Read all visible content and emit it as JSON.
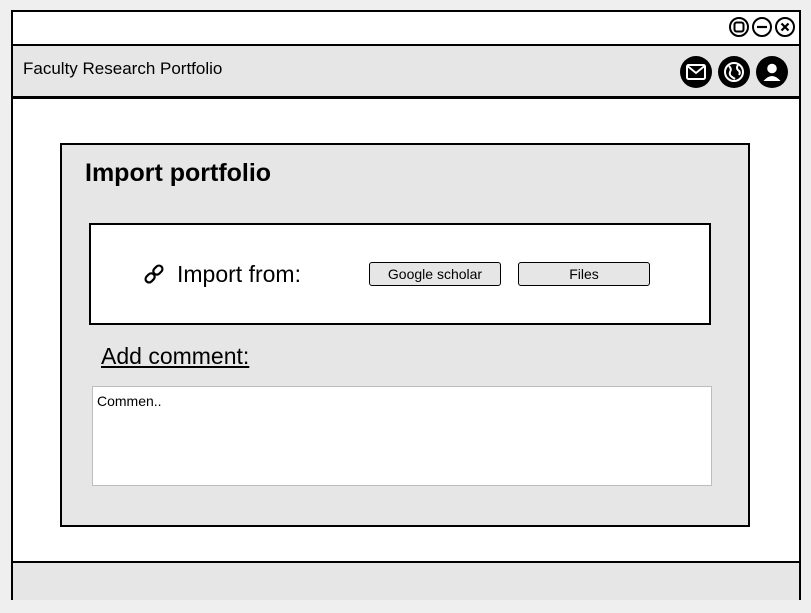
{
  "app": {
    "title": "Faculty Research Portfolio",
    "icons": [
      "mail-icon",
      "globe-icon",
      "user-icon"
    ]
  },
  "window_controls": [
    "maximize-icon",
    "minimize-icon",
    "close-icon"
  ],
  "panel": {
    "title": "Import portfolio",
    "import_label": "Import from:",
    "import_icon": "link-icon",
    "buttons": {
      "google_scholar": "Google scholar",
      "files": "Files"
    },
    "comment_label": "Add comment:",
    "comment_placeholder": "Commen.."
  },
  "colors": {
    "panel_bg": "#e6e6e6",
    "border": "#000000"
  }
}
